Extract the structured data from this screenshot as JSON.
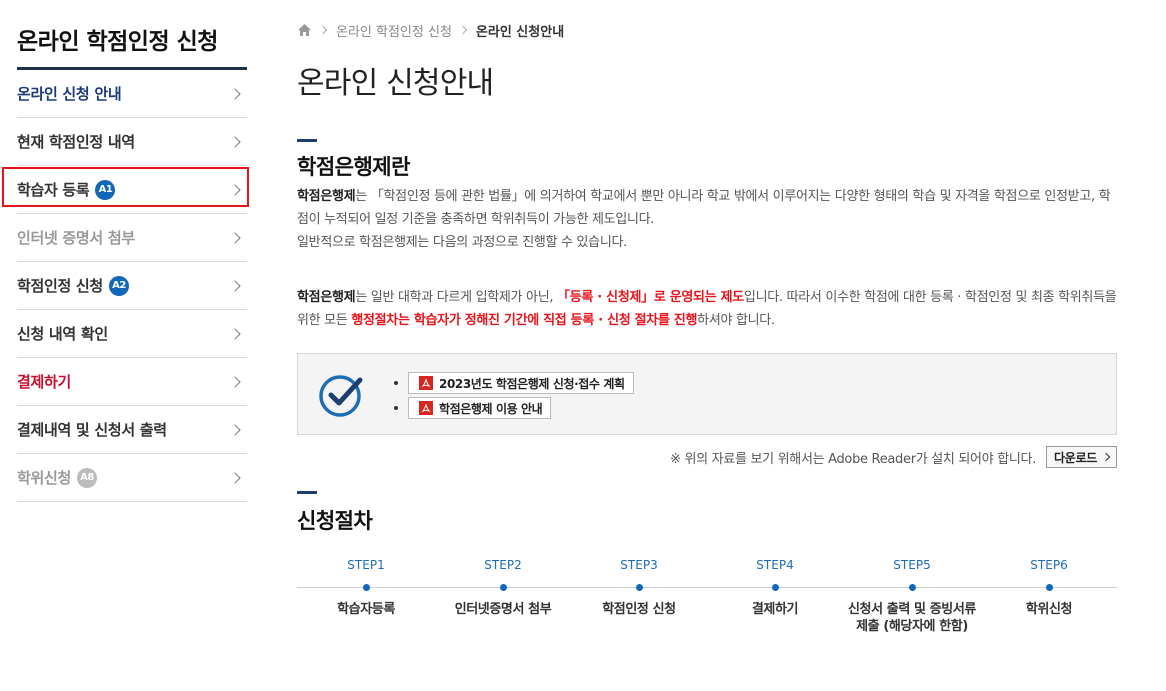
{
  "sidebar": {
    "title": "온라인 학점인정 신청",
    "items": [
      {
        "label": "온라인 신청 안내",
        "badge": ""
      },
      {
        "label": "현재 학점인정 내역",
        "badge": ""
      },
      {
        "label": "학습자 등록",
        "badge": "A1"
      },
      {
        "label": "인터넷 증명서 첨부",
        "badge": ""
      },
      {
        "label": "학점인정 신청",
        "badge": "A2"
      },
      {
        "label": "신청 내역 확인",
        "badge": ""
      },
      {
        "label": "결제하기",
        "badge": ""
      },
      {
        "label": "결제내역 및 신청서 출력",
        "badge": ""
      },
      {
        "label": "학위신청",
        "badge": "A8"
      }
    ]
  },
  "breadcrumb": {
    "items": [
      "온라인 학점인정 신청",
      "온라인 신청안내"
    ]
  },
  "page_title": "온라인 신청안내",
  "section1": {
    "title": "학점은행제란",
    "p1_bold": "학점은행제",
    "p1_rest": "는 「학점인정 등에 관한 법률」에 의거하여 학교에서 뿐만 아니라 학교 밖에서 이루어지는 다양한 형태의 학습 및 자격을 학점으로 인정받고, 학점이 누적되어 일정 기준을 충족하면 학위취득이 가능한 제도입니다.",
    "p1_line3": "일반적으로 학점은행제는 다음의 과정으로 진행할 수 있습니다.",
    "p2_bold": "학점은행제",
    "p2_a": "는 일반 대학과 다르게 입학제가 아닌, ",
    "p2_red1": "「등록 · 신청제」로 운영되는 제도",
    "p2_b": "입니다. 따라서 이수한 학점에 대한 등록 · 학점인정 및 최종 학위취득을 위한 모든 ",
    "p2_red2": "행정절차는 학습자가 정해진 기간에 직접 등록 · 신청 절차를 진행",
    "p2_c": "하셔야 합니다."
  },
  "documents": [
    {
      "label": "2023년도 학점은행제 신청·접수 계획"
    },
    {
      "label": "학점은행제 이용 안내"
    }
  ],
  "notice": {
    "text": "※ 위의 자료를 보기 위해서는 Adobe Reader가 설치 되어야 합니다.",
    "download_label": "다운로드"
  },
  "section2": {
    "title": "신청절차"
  },
  "steps": [
    {
      "num": "STEP1",
      "label": "학습자등록"
    },
    {
      "num": "STEP2",
      "label": "인터넷증명서 첨부"
    },
    {
      "num": "STEP3",
      "label": "학점인정 신청"
    },
    {
      "num": "STEP4",
      "label": "결제하기"
    },
    {
      "num": "STEP5",
      "label": "신청서 출력 및 증빙서류 제출 (해당자에 한함)"
    },
    {
      "num": "STEP6",
      "label": "학위신청"
    }
  ],
  "colors": {
    "accent": "#1268b8",
    "highlight": "#e8131b",
    "nav_dark": "#1e2f48"
  }
}
